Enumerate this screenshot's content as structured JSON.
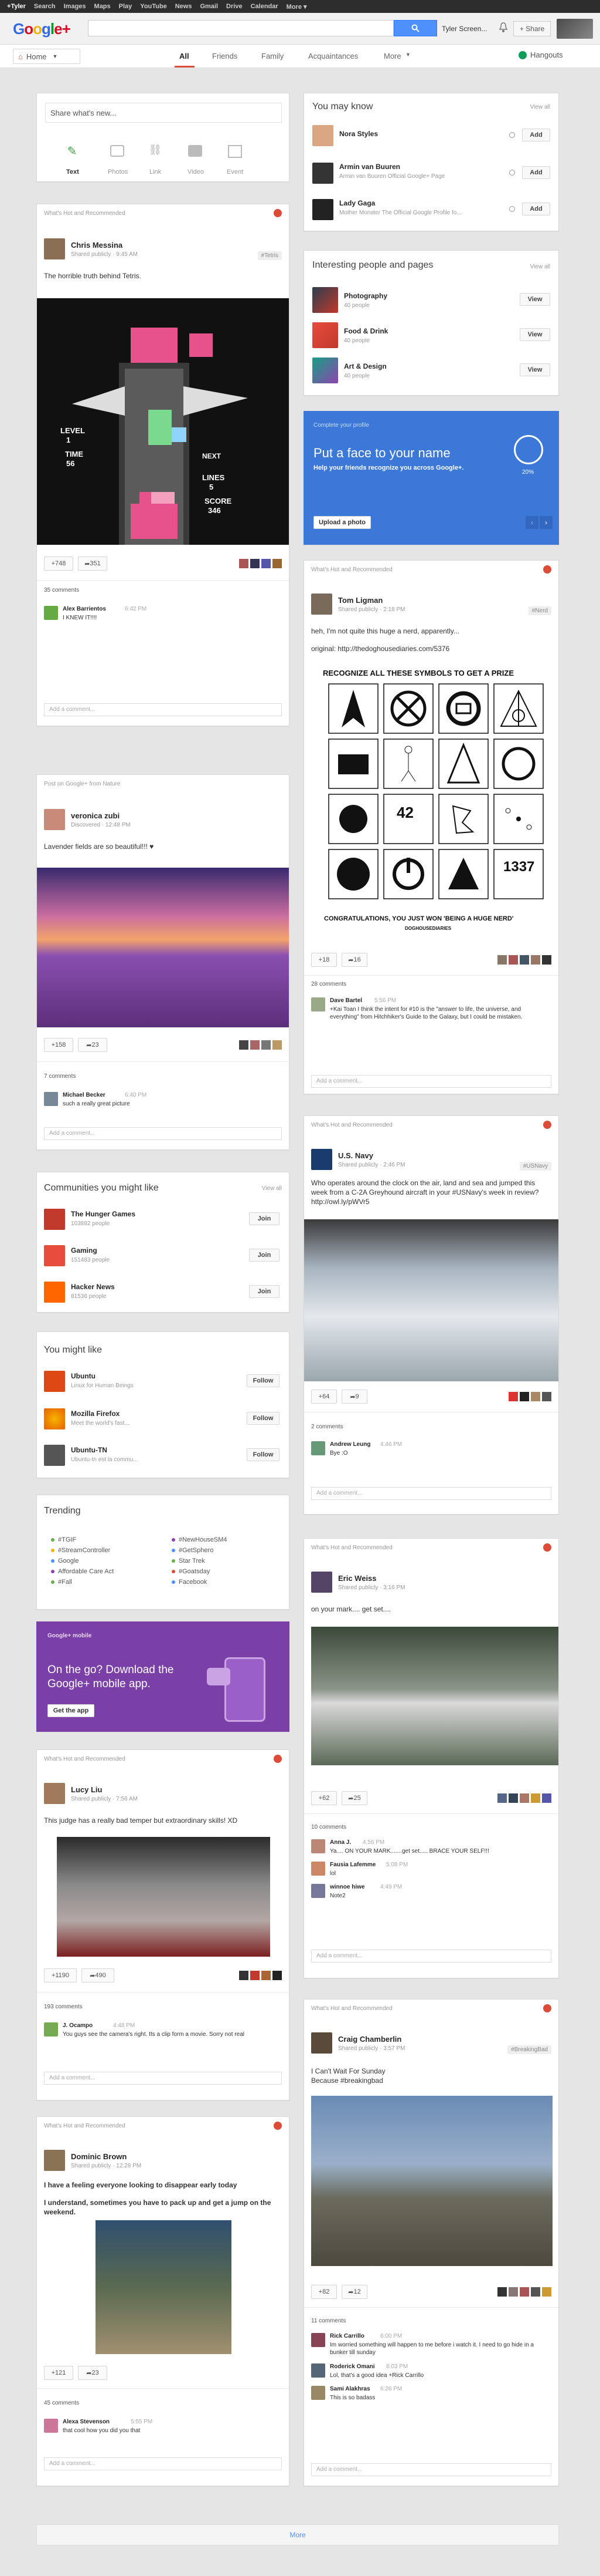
{
  "topbar": {
    "items": [
      "+Tyler",
      "Search",
      "Images",
      "Maps",
      "Play",
      "YouTube",
      "News",
      "Gmail",
      "Drive",
      "Calendar",
      "More ▾"
    ]
  },
  "header": {
    "logo": "Google+",
    "user": "Tyler Screen...",
    "share": "+ Share"
  },
  "nav": {
    "home": "Home",
    "tabs": [
      "All",
      "Friends",
      "Family",
      "Acquaintances",
      "More"
    ],
    "hangouts": "Hangouts"
  },
  "share_box": {
    "placeholder": "Share what's new...",
    "actions": [
      "Text",
      "Photos",
      "Link",
      "Video",
      "Event"
    ]
  },
  "post1": {
    "label": "What's Hot and Recommended",
    "name": "Chris Messina",
    "sub": "Shared publicly  ·  9:45 AM",
    "tag": "#Tetris",
    "text": "The horrible truth behind Tetris.",
    "plus": "+748",
    "shares": "351",
    "comments": "35 comments",
    "commenter": "Alex Barrientos",
    "ctime": "6:42 PM",
    "ctext": "I KNEW IT!!!!",
    "add": "Add a comment...",
    "image_text": {
      "level": "LEVEL",
      "level_val": "1",
      "time": "TIME",
      "time_val": "56",
      "lines": "LINES",
      "lines_val": "5",
      "score": "SCORE",
      "score_val": "346",
      "next": "NEXT"
    }
  },
  "post2": {
    "label": "Post on Google+ from Nature",
    "name": "veronica zubi",
    "sub": "Discovered  ·  12:48 PM",
    "text": "Lavender fields are so beautiful!!! ♥",
    "plus": "+158",
    "shares": "23",
    "comments": "7 comments",
    "commenter": "Michael Becker",
    "ctime": "6:40 PM",
    "ctext": "such a really great picture",
    "add": "Add a comment..."
  },
  "communities": {
    "title": "Communities you might like",
    "viewall": "View all",
    "items": [
      {
        "name": "The Hunger Games",
        "sub": "103892 people",
        "btn": "Join"
      },
      {
        "name": "Gaming",
        "sub": "151483 people",
        "btn": "Join"
      },
      {
        "name": "Hacker News",
        "sub": "81536 people",
        "btn": "Join"
      }
    ]
  },
  "mightlike": {
    "title": "You might like",
    "items": [
      {
        "name": "Ubuntu",
        "sub": "Linux for Human Beings",
        "btn": "Follow"
      },
      {
        "name": "Mozilla Firefox",
        "sub": "Meet the world's fast...",
        "btn": "Follow"
      },
      {
        "name": "Ubuntu-TN",
        "sub": "Ubuntu-tn est la commu...",
        "btn": "Follow"
      }
    ]
  },
  "trending": {
    "title": "Trending",
    "col1": [
      "#TGIF",
      "#StreamController",
      "Google",
      "Affordable Care Act",
      "#Fall"
    ],
    "col2": [
      "#NewHouseSM4",
      "#GetSphero",
      "Star Trek",
      "#Goatsday",
      "Facebook"
    ]
  },
  "mobile": {
    "label": "Google+ mobile",
    "text": "On the go? Download the Google+ mobile app.",
    "btn": "Get the app"
  },
  "post3": {
    "label": "What's Hot and Recommended",
    "name": "Lucy Liu",
    "sub": "Shared publicly  ·  7:56 AM",
    "text": "This judge has a really bad temper but extraordinary skills!  XD",
    "plus": "+1190",
    "shares": "490",
    "comments": "193 comments",
    "commenter": "J. Ocampo",
    "ctime": "4:48 PM",
    "ctext": "You guys see the camera's right. Its a clip form a movie. Sorry not real",
    "add": "Add a comment..."
  },
  "post4": {
    "label": "What's Hot and Recommended",
    "name": "Dominic Brown",
    "sub": "Shared publicly  ·  12:28 PM",
    "text1": "I have a feeling everyone looking to disappear early today",
    "text2": "I understand, sometimes you have to pack up and get a jump on the weekend.",
    "plus": "+121",
    "shares": "23",
    "comments": "45 comments",
    "commenter": "Alexa Stevenson",
    "ctime": "5:55 PM",
    "ctext": "that  cool how you did you  that",
    "add": "Add a comment..."
  },
  "youmayknow": {
    "title": "You may know",
    "viewall": "View all",
    "items": [
      {
        "name": "Nora Styles",
        "sub": "",
        "btn": "Add"
      },
      {
        "name": "Armin van Buuren",
        "sub": "Armin van Buuren Official Google+ Page",
        "btn": "Add"
      },
      {
        "name": "Lady Gaga",
        "sub": "Mother Monster The Official Google Profile fo...",
        "btn": "Add"
      }
    ]
  },
  "interesting": {
    "title": "Interesting people and pages",
    "viewall": "View all",
    "items": [
      {
        "name": "Photography",
        "sub": "40 people",
        "btn": "View"
      },
      {
        "name": "Food & Drink",
        "sub": "40 people",
        "btn": "View"
      },
      {
        "name": "Art & Design",
        "sub": "40 people",
        "btn": "View"
      }
    ]
  },
  "profile": {
    "label": "Complete your profile",
    "title": "Put a face to your name",
    "text": "Help your friends recognize you across Google+.",
    "percent": "20%",
    "btn": "Upload a photo"
  },
  "post5": {
    "label": "What's Hot and Recommended",
    "name": "Tom Ligman",
    "sub": "Shared publicly  ·  2:18 PM",
    "tag": "#Nerd",
    "text": "heh, I'm not quite this huge a nerd, apparently...",
    "link": "original: http://thedoghousediaries.com/5376",
    "img_title": "RECOGNIZE ALL THESE SYMBOLS TO GET A PRIZE",
    "img_foot": "CONGRATULATIONS, YOU JUST WON 'BEING A HUGE NERD'",
    "img_credit": "DOGHOUSEDIARIES",
    "num": "42",
    "num2": "1337",
    "plus": "+18",
    "shares": "16",
    "comments": "28 comments",
    "commenter": "Dave Bartel",
    "ctime": "5:56 PM",
    "ctext": "+Kai Toan I think the intent for #10 is the \"answer to life, the universe, and everything\" from Hitchhiker's Guide to the Galaxy, but I could be mistaken.",
    "add": "Add a comment..."
  },
  "post6": {
    "label": "What's Hot and Recommended",
    "name": "U.S. Navy",
    "sub": "Shared publicly  ·  2:46 PM",
    "tag": "#USNavy",
    "text": "Who operates around the clock on the air, land and sea and jumped this week from a C-2A Greyhound aircraft in your #USNavy's week in review? http://owl.ly/pWVr5",
    "plus": "+64",
    "shares": "9",
    "comments": "2 comments",
    "commenter": "Andrew Leung",
    "ctime": "4:46 PM",
    "ctext": "Bye :O",
    "add": "Add a comment..."
  },
  "post7": {
    "label": "What's Hot and Recommended",
    "name": "Eric Weiss",
    "sub": "Shared publicly  ·  3:16 PM",
    "text": "on your mark.... get set....",
    "plus": "+62",
    "shares": "25",
    "comments": "10 comments",
    "c1name": "Anna J.",
    "c1time": "4:56 PM",
    "c1text": "Ya.... ON YOUR MARK.......get set..... BRACE YOUR SELF!!!",
    "c2name": "Fausia Lafemme",
    "c2time": "5:08 PM",
    "c2text": "lol",
    "c3name": "winnoe hiwe",
    "c3time": "4:49 PM",
    "c3text": "Note2",
    "add": "Add a comment..."
  },
  "post8": {
    "label": "What's Hot and Recommended",
    "name": "Craig Chamberlin",
    "sub": "Shared publicly  ·  3:57 PM",
    "tag": "#BreakingBad",
    "text1": "I Can't Wait For Sunday",
    "text2": "Because #breakingbad",
    "plus": "+82",
    "shares": "12",
    "comments": "11 comments",
    "c1name": "Rick Carrillo",
    "c1time": "6:00 PM",
    "c1text": "Im worried something will happen to me before i watch it. I need to go hide in a bunker till sunday",
    "c2name": "Roderick Omani",
    "c2time": "6:03 PM",
    "c2text": "Lol, that's a good idea +Rick Carrillo",
    "c3name": "Sami Alakhras",
    "c3time": "6:26 PM",
    "c3text": "This is so badass",
    "add": "Add a comment..."
  },
  "more": "More",
  "colors": {
    "accent": "#dd4b39",
    "blue": "#4d90fe",
    "purple": "#7b3fa8",
    "profileBlue": "#3c78d8"
  }
}
